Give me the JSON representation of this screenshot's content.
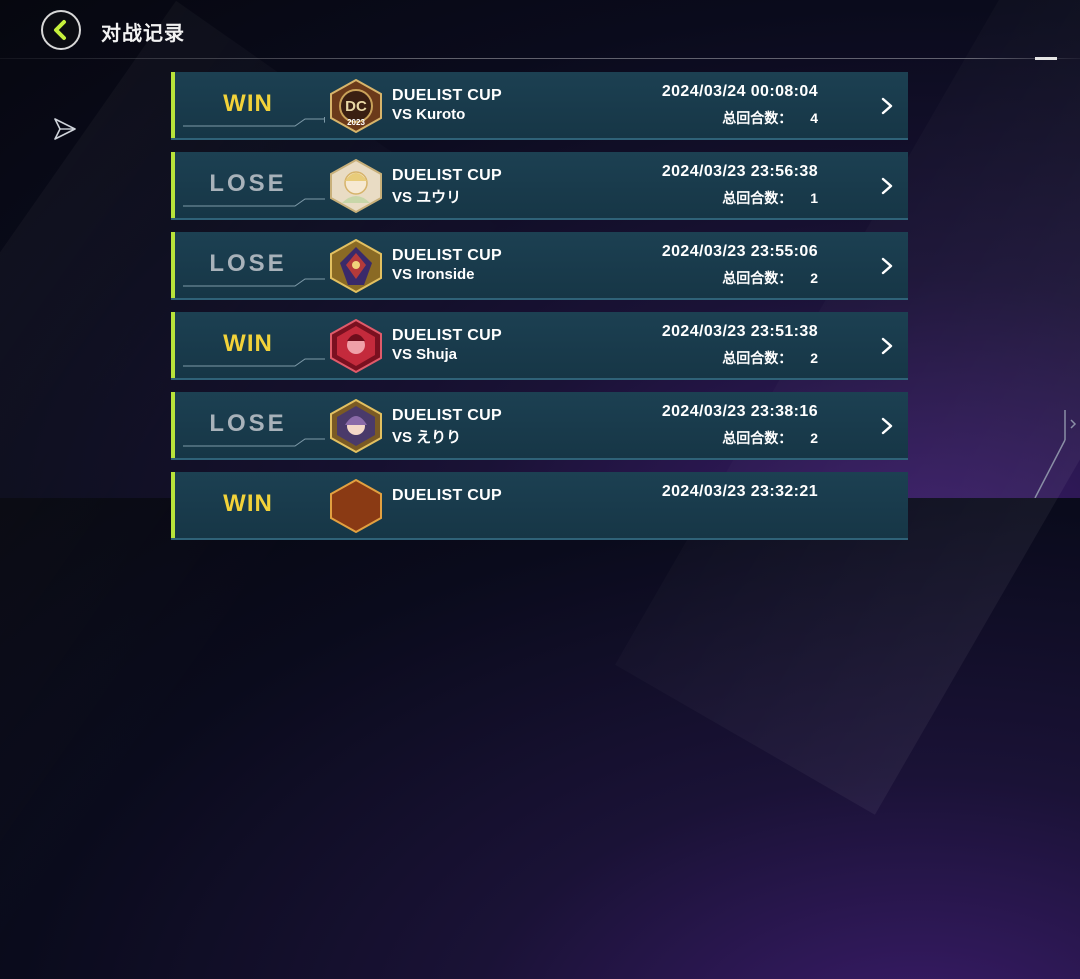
{
  "header": {
    "title": "对战记录"
  },
  "colors": {
    "accent": "#b8e33a",
    "win": "#f2d23a",
    "lose": "#a8b2ba",
    "row_bg": "#1a3c4c"
  },
  "records": [
    {
      "result": "WIN",
      "event": "DUELIST CUP",
      "opponent": "VS Kuroto",
      "datetime": "2024/03/24 00:08:04",
      "rounds_label": "总回合数：",
      "rounds": "4",
      "avatar": "dc-2023-medal-icon"
    },
    {
      "result": "LOSE",
      "event": "DUELIST CUP",
      "opponent": "VS ユウリ",
      "datetime": "2024/03/23 23:56:38",
      "rounds_label": "总回合数：",
      "rounds": "1",
      "avatar": "character-avatar-icon"
    },
    {
      "result": "LOSE",
      "event": "DUELIST CUP",
      "opponent": "VS Ironside",
      "datetime": "2024/03/23 23:55:06",
      "rounds_label": "总回合数：",
      "rounds": "2",
      "avatar": "dragon-avatar-icon"
    },
    {
      "result": "WIN",
      "event": "DUELIST CUP",
      "opponent": "VS Shuja",
      "datetime": "2024/03/23 23:51:38",
      "rounds_label": "总回合数：",
      "rounds": "2",
      "avatar": "red-gem-avatar-icon"
    },
    {
      "result": "LOSE",
      "event": "DUELIST CUP",
      "opponent": "VS えりり",
      "datetime": "2024/03/23 23:38:16",
      "rounds_label": "总回合数：",
      "rounds": "2",
      "avatar": "character-avatar-icon"
    },
    {
      "result": "WIN",
      "event": "DUELIST CUP",
      "opponent": "",
      "datetime": "2024/03/23 23:32:21",
      "rounds_label": "",
      "rounds": "",
      "avatar": "character-avatar-icon"
    }
  ]
}
